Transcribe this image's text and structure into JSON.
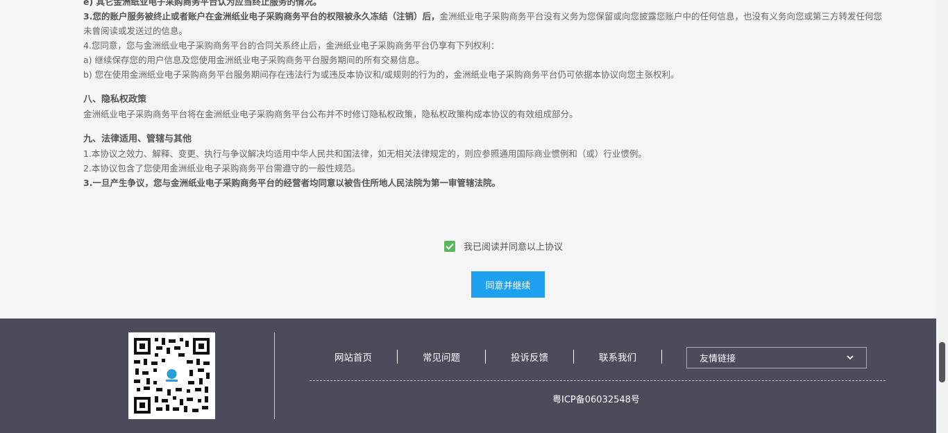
{
  "agreement": {
    "lines": [
      {
        "text": "e) 其它金洲纸业电子采购商务平台认为应当终止服务的情况。",
        "bold": true
      },
      {
        "bold_part": "3.您的账户服务被终止或者账户在金洲纸业电子采购商务平台的权限被永久冻结（注销）后，",
        "rest": "金洲纸业电子采购商务平台没有义务为您保留或向您披露您账户中的任何信息，也没有义务向您或第三方转发任何您"
      },
      {
        "text": "未曾阅读或发送过的信息。"
      },
      {
        "text": "4.您同意，您与金洲纸业电子采购商务平台的合同关系终止后，金洲纸业电子采购商务平台仍享有下列权利："
      },
      {
        "text": "a) 继续保存您的用户信息及您使用金洲纸业电子采购商务平台服务期间的所有交易信息。"
      },
      {
        "text": "b) 您在使用金洲纸业电子采购商务平台服务期间存在违法行为或违反本协议和/或规则的行为的，金洲纸业电子采购商务平台仍可依据本协议向您主张权利。"
      }
    ],
    "privacy_title": "八、隐私权政策",
    "privacy_text": "金洲纸业电子采购商务平台将在金洲纸业电子采购商务平台公布并不时修订隐私权政策，隐私权政策构成本协议的有效组成部分。",
    "law_title": "九、法律适用、管辖与其他",
    "law_1": "1.本协议之效力、解释、变更、执行与争议解决均适用中华人民共和国法律，如无相关法律规定的，则应参照通用国际商业惯例和（或）行业惯例。",
    "law_2": "2.本协议包含了您使用金洲纸业电子采购商务平台需遵守的一般性规范。",
    "law_3": "3.一旦产生争议，您与金洲纸业电子采购商务平台的经营者均同意以被告住所地人民法院为第一审管辖法院。"
  },
  "agree_label": "我已阅读并同意以上协议",
  "agree_checked": true,
  "continue_button": "同意并继续",
  "footer": {
    "nav": [
      "网站首页",
      "常见问题",
      "投诉反馈",
      "联系我们"
    ],
    "friend_links": "友情链接",
    "icp": "粤ICP备06032548号"
  },
  "colors": {
    "footer_bg": "#4a4c5c",
    "button_bg": "#1ea0f0",
    "checkbox": "#5cb85c"
  }
}
